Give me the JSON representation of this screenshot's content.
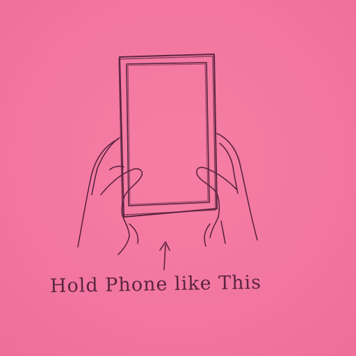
{
  "caption": "Hold Phone like This",
  "colors": {
    "paper": "#f37aa0",
    "pencil": "#5a2440"
  },
  "icons": {
    "arrow": "up-arrow-icon"
  }
}
